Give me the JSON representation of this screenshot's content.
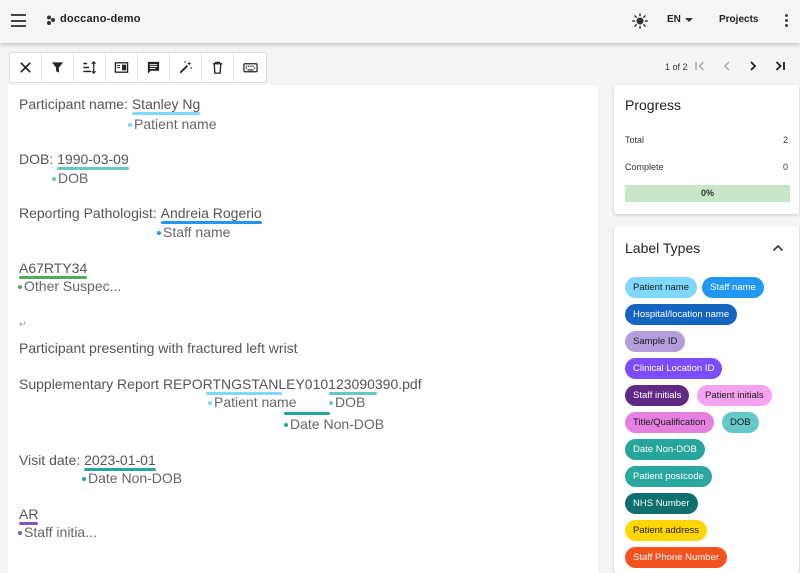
{
  "appbar": {
    "title": "doccano-demo",
    "language": "EN",
    "projects_label": "Projects",
    "menu_icon": "hamburger-icon",
    "theme_icon": "sun-icon",
    "more_icon": "vertical-dots-icon"
  },
  "toolbar": {
    "buttons": [
      {
        "icon": "close-icon"
      },
      {
        "icon": "filter-icon"
      },
      {
        "icon": "sort-icon"
      },
      {
        "icon": "split-view-icon"
      },
      {
        "icon": "comment-icon"
      },
      {
        "icon": "magic-wand-icon"
      },
      {
        "icon": "trash-icon"
      },
      {
        "icon": "keyboard-icon"
      }
    ]
  },
  "pager": {
    "text": "1 of 2",
    "first_icon": "first-page-icon",
    "prev_icon": "chevron-left-icon",
    "next_icon": "chevron-right-icon",
    "last_icon": "last-page-icon"
  },
  "document": {
    "l1_prefix": "Participant name: ",
    "l1_entity": "Stanley Ng",
    "l1_label": "Patient name",
    "l2_prefix": "DOB: ",
    "l2_entity": "1990-03-09",
    "l2_label": "DOB",
    "l3_prefix": "Reporting Pathologist: ",
    "l3_entity": "Andreia Rogerio",
    "l3_label": "Staff name",
    "l4_entity": "A67RTY34",
    "l4_label": "Other Suspec...",
    "return_mark": "↵",
    "l5_text": "Participant presenting with fractured left wrist",
    "l6_text": "Supplementary Report REPORTNGSTANLEY010123090390.pdf",
    "l6_label_a": "Patient name",
    "l6_label_b": "DOB",
    "l6_label_c": "Date Non-DOB",
    "l7_prefix": "Visit date: ",
    "l7_entity": "2023-01-01",
    "l7_label": "Date Non-DOB",
    "l8_entity": "AR",
    "l8_label": "Staff initia..."
  },
  "progress": {
    "title": "Progress",
    "total_label": "Total",
    "total_value": "2",
    "complete_label": "Complete",
    "complete_value": "0",
    "percent_text": "0%",
    "percent": 0
  },
  "label_types": {
    "title": "Label Types",
    "collapse_icon": "chevron-up-icon",
    "chips": [
      {
        "label": "Patient name",
        "bg": "#80d8ff",
        "fg": "#1a1a1a"
      },
      {
        "label": "Staff name",
        "bg": "#2196f3",
        "fg": "#ffffff"
      },
      {
        "label": "Hospital/location name",
        "bg": "#1565c0",
        "fg": "#ffffff"
      },
      {
        "label": "Sample ID",
        "bg": "#b39ddb",
        "fg": "#1a1a1a"
      },
      {
        "label": "Clinical Location ID",
        "bg": "#7c4dff",
        "fg": "#ffffff"
      },
      {
        "label": "Staff initials",
        "bg": "#5e2a84",
        "fg": "#ffffff"
      },
      {
        "label": "Patient initials",
        "bg": "#f5a3f0",
        "fg": "#1a1a1a"
      },
      {
        "label": "Title/Qualification",
        "bg": "#e57fe0",
        "fg": "#1a1a1a"
      },
      {
        "label": "DOB",
        "bg": "#64c8c8",
        "fg": "#1a1a1a"
      },
      {
        "label": "Date Non-DOB",
        "bg": "#26a69a",
        "fg": "#ffffff"
      },
      {
        "label": "Patient postcode",
        "bg": "#2aa8a0",
        "fg": "#ffffff"
      },
      {
        "label": "NHS Number",
        "bg": "#0f6e6e",
        "fg": "#ffffff"
      },
      {
        "label": "Patient address",
        "bg": "#ffd600",
        "fg": "#1a1a1a"
      },
      {
        "label": "Staff Phone Number",
        "bg": "#f4511e",
        "fg": "#ffffff"
      }
    ]
  },
  "colors": {
    "patient_name": "#80d8ff",
    "staff_name": "#2196f3",
    "dob": "#64c8c8",
    "date_non_dob": "#26a69a",
    "other": "#4caf50",
    "staff_initials": "#7e57c2"
  }
}
